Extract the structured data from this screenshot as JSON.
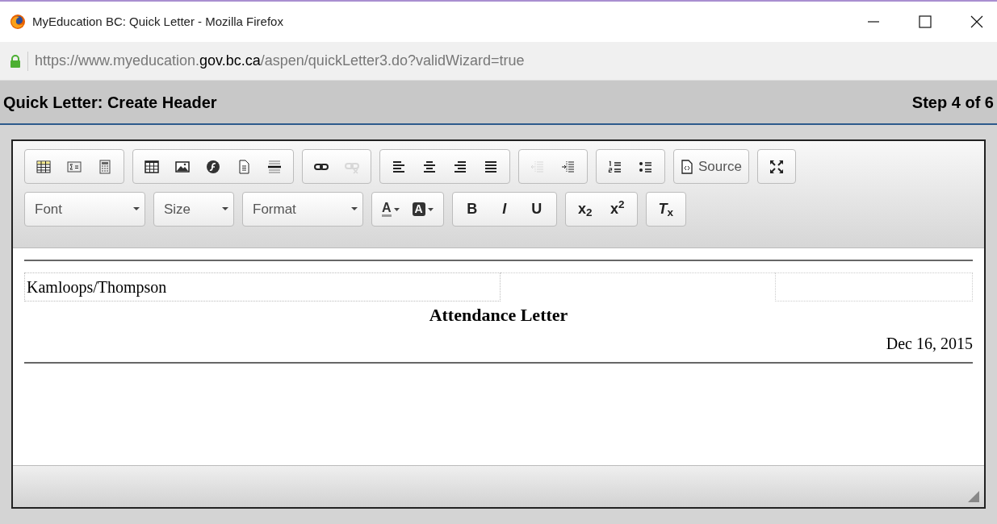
{
  "window": {
    "title": "MyEducation BC: Quick Letter - Mozilla Firefox"
  },
  "address_bar": {
    "url_start": "https://www.myeducation.",
    "url_domain": "gov.bc.ca",
    "url_end": "/aspen/quickLetter3.do?validWizard=true"
  },
  "page_header": {
    "title": "Quick Letter: Create Header",
    "step": "Step 4 of 6"
  },
  "toolbar": [
    [
      {
        "items": [
          {
            "kind": "icon",
            "disabled": false
          },
          {
            "kind": "icon",
            "disabled": false
          },
          {
            "kind": "icon",
            "disabled": false
          }
        ]
      },
      {
        "items": [
          {
            "kind": "icon",
            "disabled": false
          },
          {
            "kind": "icon",
            "disabled": false
          },
          {
            "kind": "icon",
            "disabled": false
          },
          {
            "kind": "icon",
            "disabled": false
          },
          {
            "kind": "icon",
            "disabled": false
          }
        ]
      },
      {
        "items": [
          {
            "kind": "icon",
            "disabled": false
          },
          {
            "kind": "icon",
            "disabled": true
          }
        ]
      },
      {
        "items": [
          {
            "kind": "icon",
            "disabled": false
          },
          {
            "kind": "icon",
            "disabled": false
          },
          {
            "kind": "icon",
            "disabled": false
          },
          {
            "kind": "icon",
            "disabled": false
          }
        ]
      },
      {
        "items": [
          {
            "kind": "icon",
            "disabled": true
          },
          {
            "kind": "icon",
            "disabled": false
          }
        ]
      },
      {
        "items": [
          {
            "kind": "icon",
            "disabled": false
          },
          {
            "kind": "icon",
            "disabled": false
          }
        ]
      },
      {
        "items": [
          {
            "kind": "source",
            "label": "Source"
          }
        ]
      },
      {
        "items": [
          {
            "kind": "icon",
            "disabled": false
          }
        ]
      }
    ],
    [
      {
        "items": [
          {
            "kind": "combo",
            "label": "Font"
          }
        ]
      },
      {
        "items": [
          {
            "kind": "combo",
            "label": "Size"
          }
        ]
      },
      {
        "items": [
          {
            "kind": "combo",
            "label": "Format"
          }
        ]
      },
      {
        "items": [
          {
            "kind": "text-color",
            "label": "A"
          },
          {
            "kind": "bg-color",
            "label": "A"
          }
        ]
      },
      {
        "items": [
          {
            "kind": "glyph",
            "label": "B"
          },
          {
            "kind": "glyph",
            "label": "*I*"
          },
          {
            "kind": "glyph",
            "label": "U"
          }
        ]
      },
      {
        "items": [
          {
            "kind": "glyph",
            "label": "x$_{2}$"
          },
          {
            "kind": "glyph",
            "label": "x$^{2}$"
          }
        ]
      },
      {
        "items": [
          {
            "kind": "glyph",
            "label": "*T*$_{x}$"
          }
        ]
      }
    ]
  ],
  "document": {
    "region": "Kamloops/Thompson",
    "heading": "Attendance Letter",
    "date": "Dec 16, 2015"
  }
}
